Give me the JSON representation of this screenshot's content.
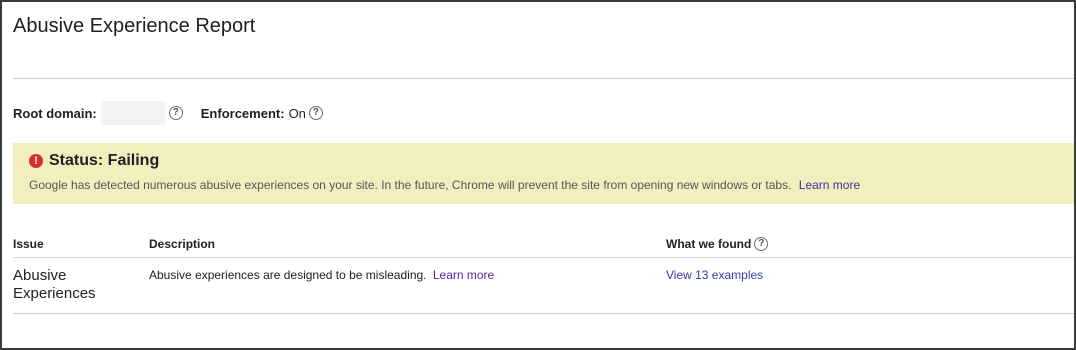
{
  "header": {
    "title": "Abusive Experience Report"
  },
  "site_info": {
    "root_domain_label": "Root domain:",
    "root_domain_value": "",
    "enforcement_label": "Enforcement:",
    "enforcement_value": "On",
    "help_glyph": "?"
  },
  "status": {
    "icon": "error-icon",
    "icon_glyph": "!",
    "title": "Status: Failing",
    "description": "Google has detected numerous abusive experiences on your site. In the future, Chrome will prevent the site from opening new windows or tabs.",
    "learn_more": "Learn more",
    "banner_color": "#f3eebe",
    "icon_color": "#d32f2f"
  },
  "table": {
    "columns": [
      "Issue",
      "Description",
      "What we found"
    ],
    "rows": [
      {
        "issue": "Abusive Experiences",
        "description": "Abusive experiences are designed to be misleading.",
        "learn_more": "Learn more",
        "found": "View 13 examples"
      }
    ]
  },
  "colors": {
    "link": "#4a2a9a"
  }
}
